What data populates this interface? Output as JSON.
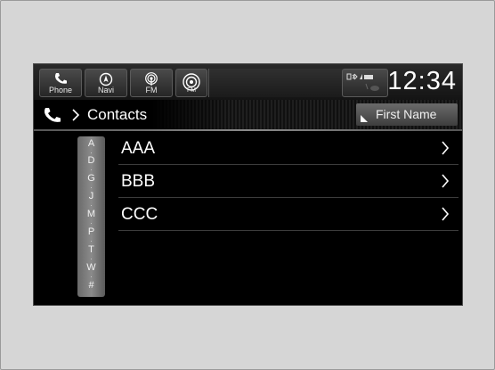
{
  "topbar": {
    "phone_label": "Phone",
    "navi_label": "Navi",
    "fm_label": "FM",
    "fm_small_label": "FM",
    "clock": "12:34"
  },
  "header": {
    "title": "Contacts",
    "sort_label": "First Name"
  },
  "index": [
    "A",
    "D",
    "G",
    "J",
    "M",
    "P",
    "T",
    "W",
    "#"
  ],
  "contacts": [
    {
      "name": "AAA"
    },
    {
      "name": "BBB"
    },
    {
      "name": "CCC"
    }
  ]
}
